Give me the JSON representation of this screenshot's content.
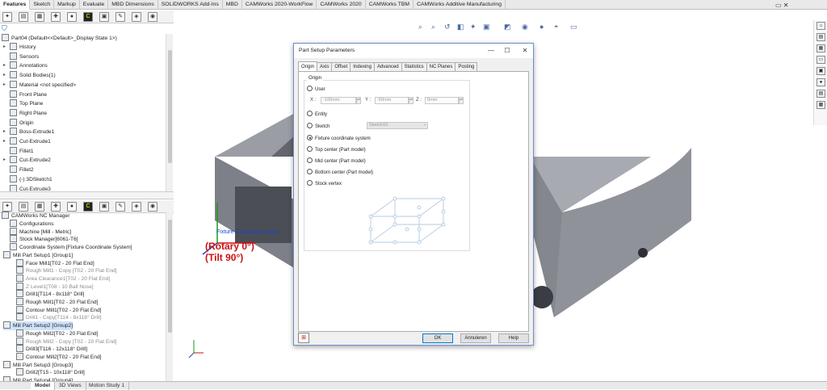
{
  "tabs": [
    "Features",
    "Sketch",
    "Markup",
    "Evaluate",
    "MBD Dimensions",
    "SOLIDWORKS Add-Ins",
    "MBD",
    "CAMWorks 2020-WorkFlow",
    "CAMWorks 2020",
    "CAMWorks TBM",
    "CAMWorks Additive Manufacturing"
  ],
  "feature_tree": {
    "root": "Part04  (Default<<Default>_Display State 1>)",
    "items": [
      "History",
      "Sensors",
      "Annotations",
      "Solid Bodies(1)",
      "Material <not specified>",
      "Front Plane",
      "Top Plane",
      "Right Plane",
      "Origin",
      "Boss-Extrude1",
      "Cut-Extrude1",
      "Fillet1",
      "Cut-Extrude2",
      "Fillet2",
      "(-) 3DSketch1",
      "Cut-Extrude3"
    ]
  },
  "cam_tree": {
    "root": "CAMWorks NC Manager",
    "items": [
      "Configurations",
      "Machine [Mill - Metric]",
      "Stock Manager[6061-T6]",
      "Coordinate System [Fixture Coordinate System]",
      "Mill Part Setup1 [Group1]",
      "Face Mill1[T02 - 20 Flat End]",
      "Rough Mill1 - Copy [T02 - 20 Flat End]",
      "Area Clearance1[T02 - 20 Flat End]",
      "Z Level1[T08 - 10 Ball Nose]",
      "Drill1[T114 - 8x118° Drill]",
      "Rough Mill1[T02 - 20 Flat End]",
      "Contour Mill1[T02 - 20 Flat End]",
      "Drill1 - Copy[T114 - 8x118° Drill]",
      "Mill Part Setup2 [Group2]",
      "Rough Mill2[T02 - 20 Flat End]",
      "Rough Mill2 - Copy [T02 - 20 Flat End]",
      "Drill3[T116 - 12x118° Drill]",
      "Contour Mill2[T02 - 20 Flat End]",
      "Mill Part Setup3 [Group3]",
      "Drill2[T15 - 10x118° Drill]",
      "Mill Part Setup4 [Group4]"
    ]
  },
  "bottom_tabs": [
    "Model",
    "3D Views",
    "Motion Study 1"
  ],
  "viewport": {
    "coord_label": "Fixture Coordinate Syste",
    "rotary": "(Rotary 0°)",
    "tilt": "(Tilt 90°)"
  },
  "dialog": {
    "title": "Part Setup Parameters",
    "tabs": [
      "Origin",
      "Axis",
      "Offset",
      "Indexing",
      "Advanced",
      "Statistics",
      "NC Planes",
      "Posting"
    ],
    "group_label": "Origin",
    "options": {
      "user": "User",
      "entity": "Entity",
      "sketch": "Sketch",
      "fixture": "Fixture coordinate system",
      "top": "Top center (Part model)",
      "mid": "Mid center (Part model)",
      "bottom": "Bottom center (Part model)",
      "stock": "Stock vertex"
    },
    "x_label": "X :",
    "x_value": "-100mm",
    "y_label": "Y :",
    "y_value": "-50mm",
    "z_label": "Z :",
    "z_value": "0mm",
    "sketch_value": "Sketch10",
    "ok": "OK",
    "cancel": "Annuleren",
    "help": "Help"
  },
  "colors": {
    "accent": "#0078d7",
    "selected": "#cfe3fb",
    "part_gray": "#8c8f96",
    "axis_red": "#cc1111",
    "axis_green": "#1a9a1a",
    "axis_blue": "#1a44cc"
  }
}
